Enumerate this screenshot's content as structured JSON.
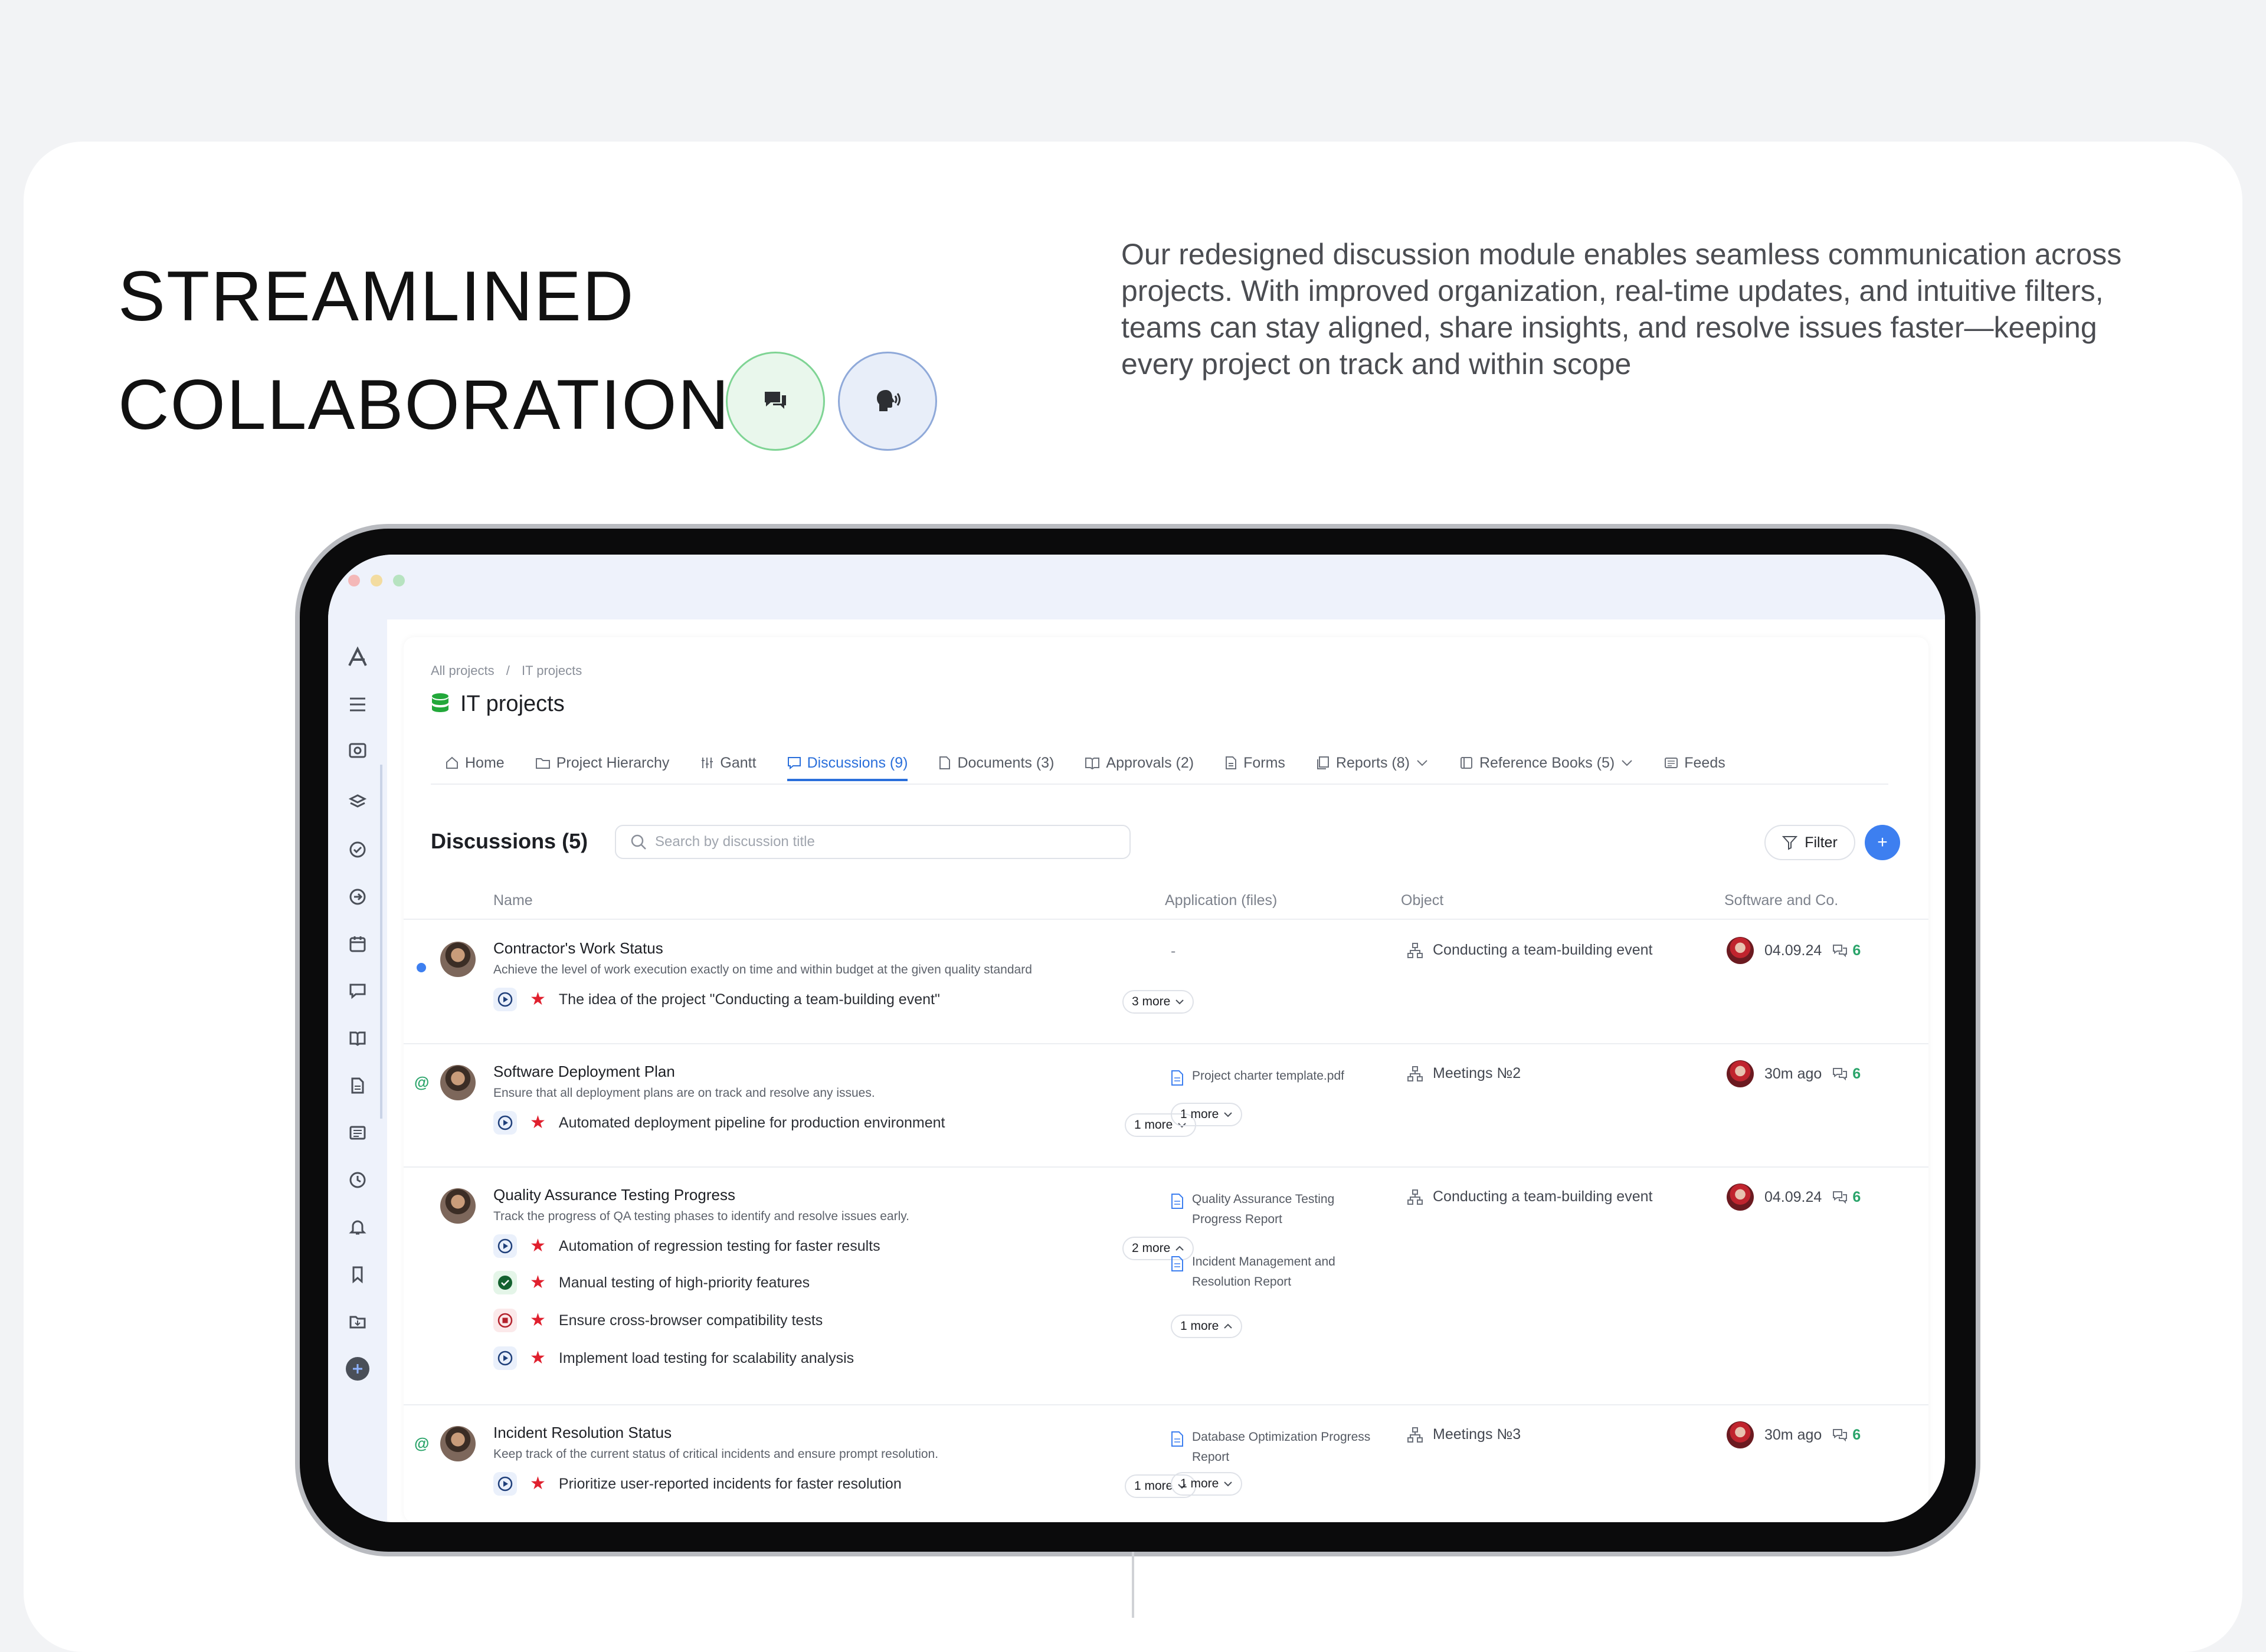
{
  "hero": {
    "title_line1": "STREAMLINED",
    "title_line2": "COLLABORATION",
    "description": "Our redesigned discussion module enables seamless communication across projects. With improved organization, real-time updates, and intuitive filters, teams can stay aligned, share insights, and resolve issues faster—keeping every project on track and within scope",
    "icons": [
      "chat-bubbles-icon",
      "speaking-head-icon"
    ]
  },
  "app": {
    "breadcrumb": {
      "root": "All projects",
      "separator": "/",
      "current": "IT projects"
    },
    "project_title": "IT projects",
    "tabs": [
      {
        "label": "Home",
        "icon": "home-icon"
      },
      {
        "label": "Project Hierarchy",
        "icon": "folder-icon"
      },
      {
        "label": "Gantt",
        "icon": "gantt-icon"
      },
      {
        "label": "Discussions (9)",
        "icon": "chat-icon",
        "active": true
      },
      {
        "label": "Documents (3)",
        "icon": "document-icon"
      },
      {
        "label": "Approvals (2)",
        "icon": "book-icon"
      },
      {
        "label": "Forms",
        "icon": "form-icon"
      },
      {
        "label": "Reports (8)",
        "icon": "report-icon",
        "dropdown": true
      },
      {
        "label": "Reference Books (5)",
        "icon": "reference-icon",
        "dropdown": true
      },
      {
        "label": "Feeds",
        "icon": "feed-icon"
      }
    ],
    "discussions_title": "Discussions (5)",
    "search_placeholder": "Search by discussion title",
    "filter_label": "Filter",
    "add_label": "+",
    "columns": {
      "name": "Name",
      "application": "Application (files)",
      "object": "Object",
      "software": "Software and Co."
    },
    "rows": [
      {
        "name": "Contractor's Work Status",
        "desc": "Achieve the level of work execution exactly on time and within budget at the given quality standard",
        "tasks": [
          {
            "text": "The idea of the project \"Conducting a team-building event\"",
            "status": "play"
          }
        ],
        "tasks_more": "3 more",
        "files_empty": "-",
        "object": "Conducting a team-building event",
        "date": "04.09.24",
        "count": "6"
      },
      {
        "name": "Software Deployment Plan",
        "desc": "Ensure that all deployment plans are on track and resolve any issues.",
        "tasks": [
          {
            "text": "Automated deployment pipeline for production environment",
            "status": "play"
          }
        ],
        "tasks_more": "1 more",
        "files": [
          "Project charter template.pdf"
        ],
        "files_more": "1 more",
        "object": "Meetings №2",
        "date": "30m ago",
        "count": "6"
      },
      {
        "name": "Quality Assurance Testing Progress",
        "desc": "Track the progress of QA testing phases to identify and resolve issues early.",
        "tasks": [
          {
            "text": "Automation of regression testing for faster results",
            "status": "play"
          },
          {
            "text": "Manual testing of high-priority features",
            "status": "done"
          },
          {
            "text": "Ensure cross-browser compatibility tests",
            "status": "stopped"
          },
          {
            "text": "Implement load testing for scalability analysis",
            "status": "play"
          }
        ],
        "tasks_more": "2 more",
        "files": [
          "Quality Assurance Testing Progress Report",
          "Incident Management and Resolution Report"
        ],
        "files_more": "1 more",
        "object": "Conducting a team-building event",
        "date": "04.09.24",
        "count": "6"
      },
      {
        "name": "Incident Resolution Status",
        "desc": "Keep track of the current status of critical incidents and ensure prompt resolution.",
        "tasks": [
          {
            "text": "Prioritize user-reported incidents for faster resolution",
            "status": "play"
          }
        ],
        "tasks_more": "1 more",
        "files": [
          "Database Optimization Progress Report"
        ],
        "files_more": "1 more",
        "object": "Meetings №3",
        "date": "30m ago",
        "count": "6"
      }
    ],
    "mention_symbol": "@",
    "colors": {
      "accent": "#2a6fdb",
      "green": "#2aa46a",
      "star": "#e0202e"
    }
  }
}
